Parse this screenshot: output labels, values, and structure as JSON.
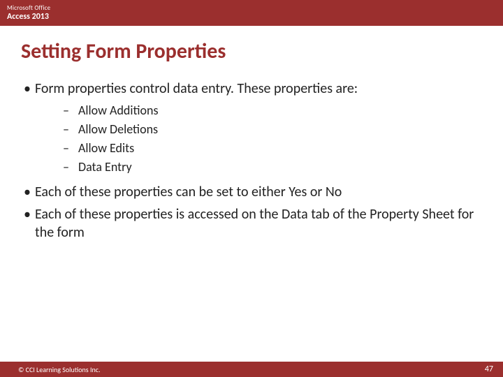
{
  "header": {
    "brand": "Microsoft Office",
    "product": "Access 2013"
  },
  "title": "Setting Form Properties",
  "bullets": [
    {
      "text": "Form properties control data entry. These properties are:"
    },
    {
      "text": "Each of these properties can be set to either Yes or No"
    },
    {
      "text": "Each of these properties is accessed on the Data tab of the Property Sheet for the form"
    }
  ],
  "sub_bullets": [
    "Allow Additions",
    "Allow Deletions",
    "Allow Edits",
    "Data Entry"
  ],
  "footer": {
    "copyright": "© CCI Learning Solutions Inc.",
    "page": "47"
  },
  "marks": {
    "bullet": "•",
    "dash": "–"
  }
}
